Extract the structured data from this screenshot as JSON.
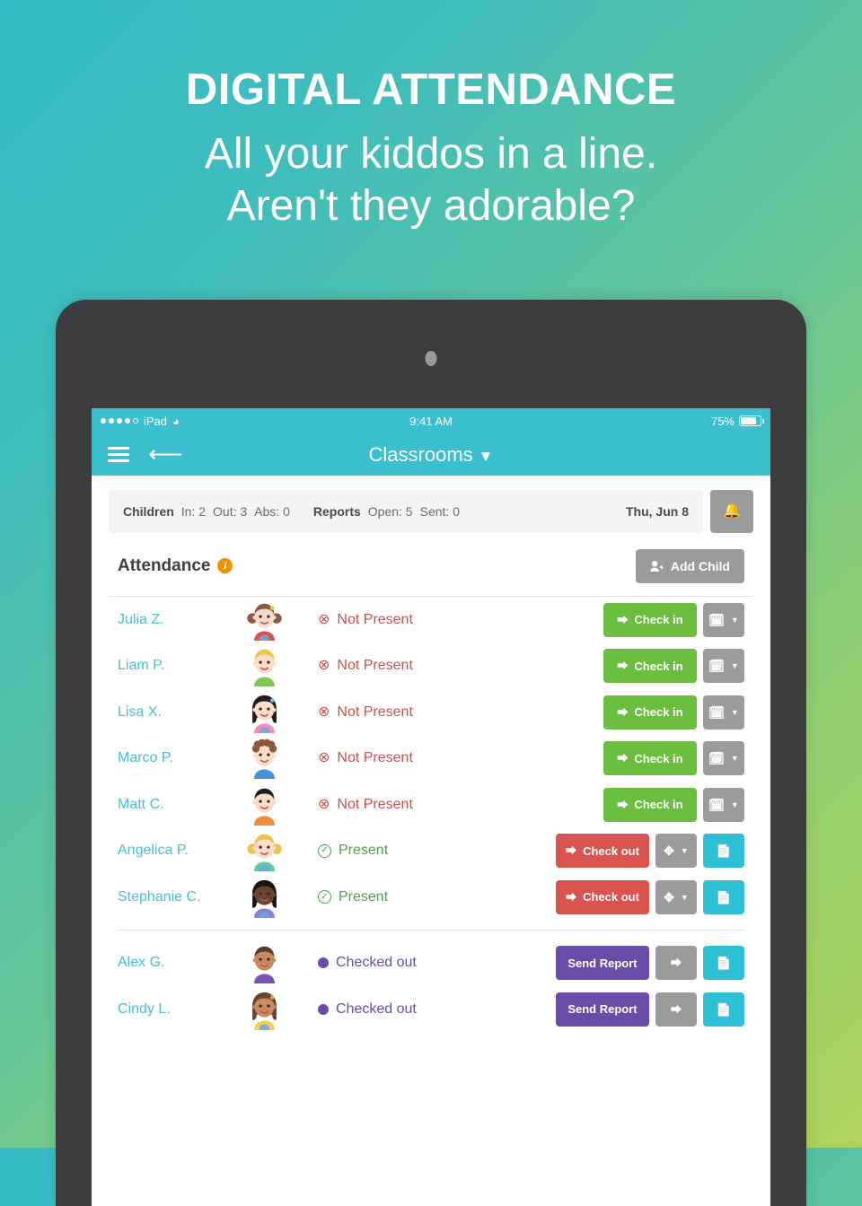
{
  "hero": {
    "title": "DIGITAL ATTENDANCE",
    "line1": "All your kiddos in a line.",
    "line2": "Aren't they adorable?"
  },
  "colors": {
    "bg_start": "#35bcc6",
    "bg_end": "#b0d45c",
    "brand_cyan": "#3cc0d0",
    "green": "#6cbe3f",
    "red": "#d9534f",
    "purple": "#6b4ba8",
    "grey": "#9b9b9b",
    "cyan_action": "#2ec0d4",
    "name_link": "#45c0d4",
    "orange_info": "#f39200"
  },
  "device": {
    "frame_color": "#3d3d3f"
  },
  "statusbar": {
    "carrier": "iPad",
    "wifi_icon": "wifi-icon",
    "time": "9:41 AM",
    "battery_percent": "75%",
    "battery_icon": "battery-icon"
  },
  "navbar": {
    "menu_icon": "hamburger-menu-icon",
    "back_icon": "arrow-left-icon",
    "title": "Classrooms",
    "caret_icon": "chevron-down-icon"
  },
  "summary": {
    "children_label": "Children",
    "in_label": "In: 2",
    "out_label": "Out: 3",
    "abs_label": "Abs: 0",
    "reports_label": "Reports",
    "open_label": "Open: 5",
    "sent_label": "Sent: 0",
    "date": "Thu, Jun 8",
    "bell_icon": "bell-icon"
  },
  "attendance": {
    "title": "Attendance",
    "info_icon": "info-icon",
    "info_char": "i",
    "add_child_label": "Add Child",
    "add_child_icon": "user-plus-icon"
  },
  "rows": [
    {
      "name": "Julia Z.",
      "status": "Not Present",
      "state": "absent",
      "avatar": "girl-brown-pigtails-red-shirt",
      "actions": [
        {
          "label": "Check in",
          "style": "green",
          "icon": "sign-in-icon",
          "kind": "primary"
        },
        {
          "label": "",
          "style": "grey",
          "icon": "calendar-absent-icon",
          "kind": "square",
          "caret": true
        }
      ]
    },
    {
      "name": "Liam P.",
      "status": "Not Present",
      "state": "absent",
      "avatar": "boy-blond-green-shirt",
      "actions": [
        {
          "label": "Check in",
          "style": "green",
          "icon": "sign-in-icon",
          "kind": "primary"
        },
        {
          "label": "",
          "style": "grey",
          "icon": "calendar-absent-icon",
          "kind": "square",
          "caret": true
        }
      ]
    },
    {
      "name": "Lisa X.",
      "status": "Not Present",
      "state": "absent",
      "avatar": "girl-black-longhair-pink-shirt",
      "actions": [
        {
          "label": "Check in",
          "style": "green",
          "icon": "sign-in-icon",
          "kind": "primary"
        },
        {
          "label": "",
          "style": "grey",
          "icon": "calendar-absent-icon",
          "kind": "square",
          "caret": true
        }
      ]
    },
    {
      "name": "Marco P.",
      "status": "Not Present",
      "state": "absent",
      "avatar": "boy-curly-brown-blue-shirt",
      "actions": [
        {
          "label": "Check in",
          "style": "green",
          "icon": "sign-in-icon",
          "kind": "primary"
        },
        {
          "label": "",
          "style": "grey",
          "icon": "calendar-absent-icon",
          "kind": "square",
          "caret": true
        }
      ]
    },
    {
      "name": "Matt C.",
      "status": "Not Present",
      "state": "absent",
      "avatar": "boy-black-hair-orange-shirt",
      "actions": [
        {
          "label": "Check in",
          "style": "green",
          "icon": "sign-in-icon",
          "kind": "primary"
        },
        {
          "label": "",
          "style": "grey",
          "icon": "calendar-absent-icon",
          "kind": "square",
          "caret": true
        }
      ]
    },
    {
      "name": "Angelica P.",
      "status": "Present",
      "state": "present",
      "avatar": "girl-blond-pigtails-green-shirt",
      "actions": [
        {
          "label": "Check out",
          "style": "red",
          "icon": "sign-out-icon",
          "kind": "wide"
        },
        {
          "label": "",
          "style": "grey",
          "icon": "move-arrows-icon",
          "kind": "square",
          "caret": true
        },
        {
          "label": "",
          "style": "cyan",
          "icon": "report-file-icon",
          "kind": "square"
        }
      ]
    },
    {
      "name": "Stephanie C.",
      "status": "Present",
      "state": "present",
      "avatar": "girl-dark-skin-black-hair-blue-shirt",
      "divider_after": true,
      "actions": [
        {
          "label": "Check out",
          "style": "red",
          "icon": "sign-out-icon",
          "kind": "wide"
        },
        {
          "label": "",
          "style": "grey",
          "icon": "move-arrows-icon",
          "kind": "square",
          "caret": true
        },
        {
          "label": "",
          "style": "cyan",
          "icon": "report-file-icon",
          "kind": "square"
        }
      ]
    },
    {
      "name": "Alex G.",
      "status": "Checked out",
      "state": "out",
      "avatar": "boy-brown-hair-purple-shirt",
      "gap_top": true,
      "actions": [
        {
          "label": "Send Report",
          "style": "purple",
          "icon": "",
          "kind": "wide"
        },
        {
          "label": "",
          "style": "grey",
          "icon": "sign-in-icon",
          "kind": "square"
        },
        {
          "label": "",
          "style": "cyan",
          "icon": "report-file-icon",
          "kind": "square"
        }
      ]
    },
    {
      "name": "Cindy L.",
      "status": "Checked out",
      "state": "out",
      "avatar": "girl-brown-hair-flower-yellow-shirt",
      "actions": [
        {
          "label": "Send Report",
          "style": "purple",
          "icon": "",
          "kind": "wide"
        },
        {
          "label": "",
          "style": "grey",
          "icon": "sign-in-icon",
          "kind": "square"
        },
        {
          "label": "",
          "style": "cyan",
          "icon": "report-file-icon",
          "kind": "square"
        }
      ]
    }
  ]
}
